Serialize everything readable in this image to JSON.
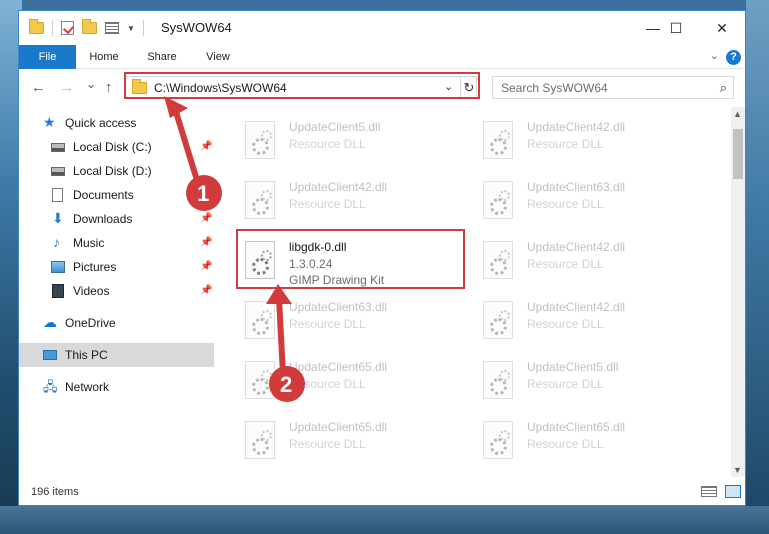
{
  "window": {
    "title": "SysWOW64",
    "controls": {
      "minimize": "—",
      "maximize": "☐",
      "close": "✕"
    }
  },
  "ribbon": {
    "tabs": [
      "File",
      "Home",
      "Share",
      "View"
    ],
    "help": "?"
  },
  "navigation": {
    "back": "←",
    "forward": "→",
    "recent": "⌄",
    "up": "↑",
    "address": "C:\\Windows\\SysWOW64",
    "search_placeholder": "Search SysWOW64"
  },
  "sidebar": {
    "items": [
      {
        "label": "Quick access",
        "icon": "star-icon"
      },
      {
        "label": "Local Disk (C:)",
        "icon": "disk-icon",
        "pinned": true
      },
      {
        "label": "Local Disk (D:)",
        "icon": "disk-icon",
        "pinned": true
      },
      {
        "label": "Documents",
        "icon": "documents-icon",
        "pinned": true
      },
      {
        "label": "Downloads",
        "icon": "download-icon",
        "pinned": true
      },
      {
        "label": "Music",
        "icon": "music-icon",
        "pinned": true
      },
      {
        "label": "Pictures",
        "icon": "pictures-icon",
        "pinned": true
      },
      {
        "label": "Videos",
        "icon": "videos-icon",
        "pinned": true
      },
      {
        "label": "OneDrive",
        "icon": "cloud-icon"
      },
      {
        "label": "This PC",
        "icon": "computer-icon",
        "selected": true
      },
      {
        "label": "Network",
        "icon": "network-icon"
      }
    ]
  },
  "files": [
    {
      "name": "UpdateClient5.dll",
      "desc": "Resource DLL"
    },
    {
      "name": "UpdateClient42.dll",
      "desc": "Resource DLL"
    },
    {
      "name": "UpdateClient42.dll",
      "desc": "Resource DLL"
    },
    {
      "name": "UpdateClient63.dll",
      "desc": "Resource DLL"
    },
    {
      "name": "libgdk-0.dll",
      "version": "1.3.0.24",
      "desc": "GIMP Drawing Kit",
      "highlighted": true
    },
    {
      "name": "UpdateClient42.dll",
      "desc": "Resource DLL"
    },
    {
      "name": "UpdateClient63.dll",
      "desc": "Resource DLL"
    },
    {
      "name": "UpdateClient42.dll",
      "desc": "Resource DLL"
    },
    {
      "name": "UpdateClient65.dll",
      "desc": "Resource DLL"
    },
    {
      "name": "UpdateClient5.dll",
      "desc": "Resource DLL"
    },
    {
      "name": "UpdateClient65.dll",
      "desc": "Resource DLL"
    },
    {
      "name": "UpdateClient65.dll",
      "desc": "Resource DLL"
    }
  ],
  "status": {
    "item_count": "196 items"
  },
  "annotations": {
    "step1": "1",
    "step2": "2",
    "color": "#d23b3b"
  }
}
